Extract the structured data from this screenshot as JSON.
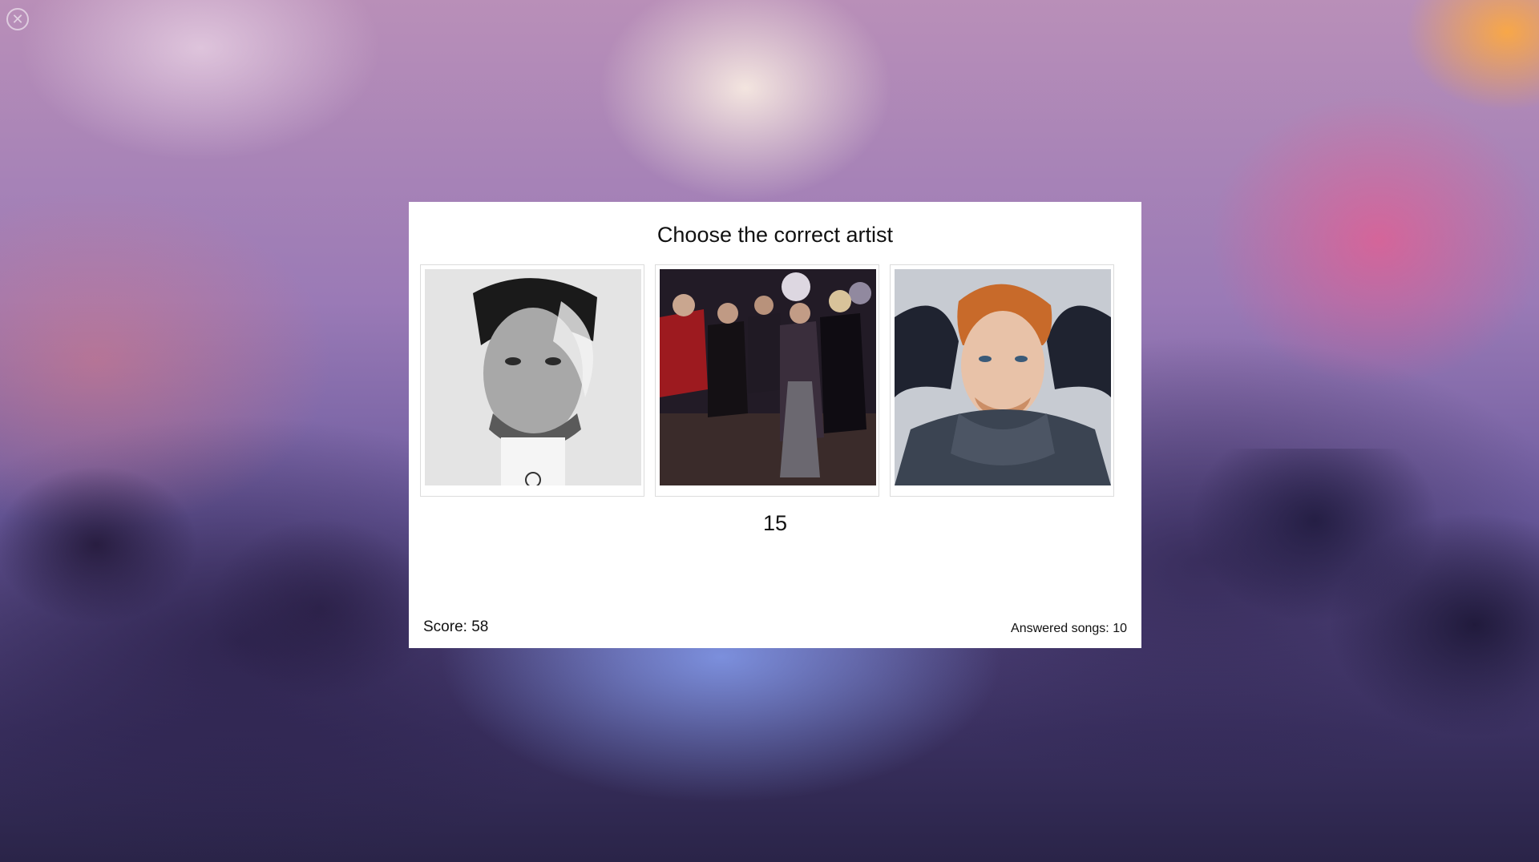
{
  "close": {
    "icon": "close-circle-icon",
    "glyph": "✕"
  },
  "quiz": {
    "title": "Choose the correct artist",
    "countdown": "15",
    "score_text": "Score: 58",
    "answered_text": "Answered songs: 10",
    "options": [
      {
        "image": "artist-photo-1"
      },
      {
        "image": "artist-photo-2"
      },
      {
        "image": "artist-photo-3"
      }
    ]
  }
}
